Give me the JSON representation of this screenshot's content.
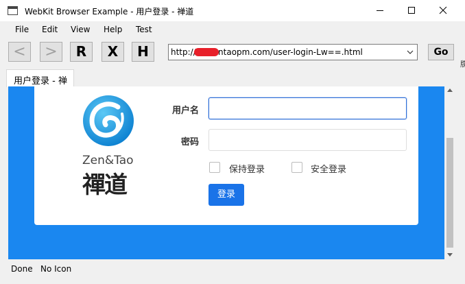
{
  "window": {
    "title": "WebKit Browser Example - 用户登录 - 禅道",
    "controls": {
      "minimize": "minimize-icon",
      "maximize": "maximize-icon",
      "close": "close-icon"
    }
  },
  "menu": {
    "items": [
      {
        "label": "File",
        "accel": "F"
      },
      {
        "label": "Edit",
        "accel": "E"
      },
      {
        "label": "View",
        "accel": "V"
      },
      {
        "label": "Help",
        "accel": "H"
      },
      {
        "label": "Test"
      }
    ]
  },
  "toolbar": {
    "back_label": "<",
    "forward_label": ">",
    "reload_label": "R",
    "stop_label": "X",
    "home_label": "H",
    "url": "http://s           t.zentaopm.com/user-login-Lw==.html",
    "go_label": "Go",
    "edge_glyph": "牒"
  },
  "tab": {
    "label": "用户登录 - 禅"
  },
  "page": {
    "logo_en": "Zen&Tao",
    "logo_cn": "禪道",
    "username_label": "用户名",
    "password_label": "密码",
    "remember_label": "保持登录",
    "secure_label": "安全登录",
    "login_button": "登录",
    "colors": {
      "background": "#1a87f0",
      "button": "#1a73e8"
    }
  },
  "status": {
    "text": "Done   No Icon"
  }
}
